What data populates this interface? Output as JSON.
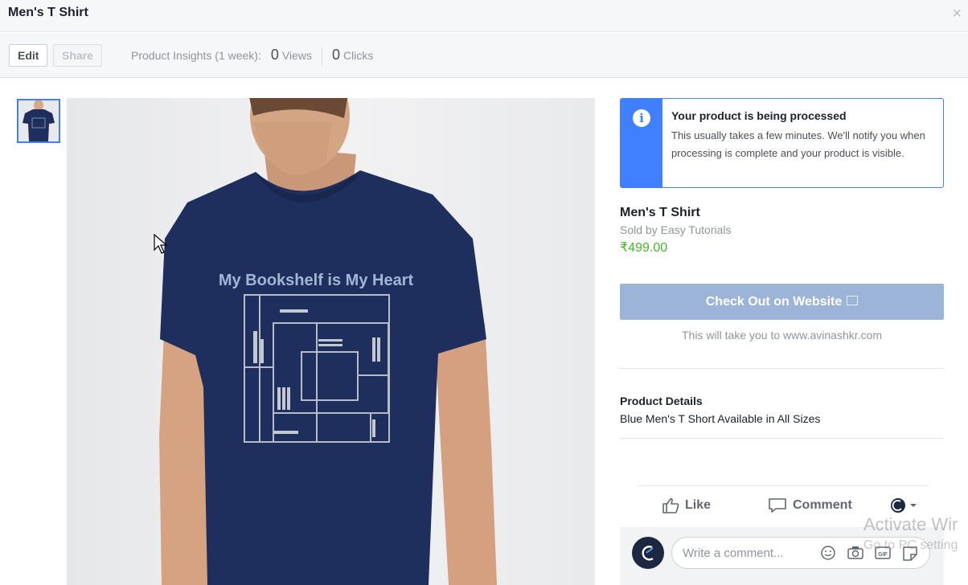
{
  "header": {
    "title": "Men's T Shirt",
    "close_label": "×"
  },
  "toolbar": {
    "edit_label": "Edit",
    "share_label": "Share",
    "insights_label": "Product Insights (1 week):",
    "views_count": "0",
    "views_label": "Views",
    "clicks_count": "0",
    "clicks_label": "Clicks"
  },
  "image": {
    "shirt_print": "My Bookshelf is My Heart"
  },
  "notice": {
    "icon": "info-icon",
    "title": "Your product is being processed",
    "body": "This usually takes a few minutes. We'll notify you when processing is complete and your product is visible."
  },
  "product": {
    "name": "Men's T Shirt",
    "seller": "Sold by Easy Tutorials",
    "price": "₹499.00",
    "checkout_label": "Check Out on Website",
    "redirect_text": "This will take you to www.avinashkr.com",
    "details_heading": "Product Details",
    "details_text": "Blue Men's T Short Available in All Sizes"
  },
  "actions": {
    "like_label": "Like",
    "comment_label": "Comment"
  },
  "comment": {
    "placeholder": "Write a comment..."
  },
  "watermark": {
    "line1": "Activate Wir",
    "line2": "Go to PC setting"
  },
  "colors": {
    "accent": "#4080ff",
    "price": "#42b72a",
    "checkout_bg": "#9cb4d8",
    "shirt": "#1e2f5e"
  }
}
